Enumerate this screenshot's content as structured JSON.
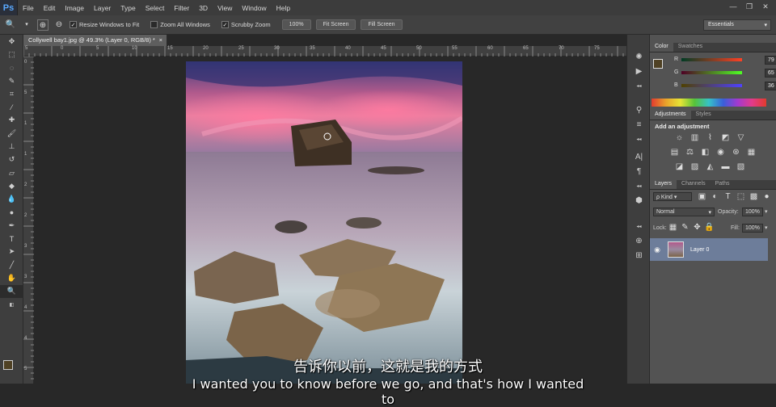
{
  "app": {
    "logo": "Ps"
  },
  "menu": [
    "File",
    "Edit",
    "Image",
    "Layer",
    "Type",
    "Select",
    "Filter",
    "3D",
    "View",
    "Window",
    "Help"
  ],
  "window_controls": [
    "—",
    "❐",
    "✕"
  ],
  "options": {
    "resize_label": "Resize Windows to Fit",
    "zoom_all_label": "Zoom All Windows",
    "scrubby_label": "Scrubby Zoom",
    "pct_button": "100%",
    "fit_button": "Fit Screen",
    "fill_button": "Fill Screen",
    "workspace": "Essentials"
  },
  "document": {
    "tab_title": "Collywell bay1.jpg @ 49.3% (Layer 0, RGB/8) *",
    "close": "×"
  },
  "ruler": {
    "h_labels": [
      "5",
      "0",
      "5",
      "10",
      "15",
      "20",
      "25",
      "30",
      "35",
      "40",
      "45",
      "50",
      "55",
      "60",
      "65",
      "70",
      "75"
    ],
    "v_labels": [
      "0",
      "5",
      "1",
      "1",
      "2",
      "2",
      "3",
      "3",
      "4",
      "4",
      "5"
    ]
  },
  "color_panel": {
    "tabs": [
      "Color",
      "Swatches"
    ],
    "r": {
      "label": "R",
      "value": "79"
    },
    "g": {
      "label": "G",
      "value": "65"
    },
    "b": {
      "label": "B",
      "value": "36"
    },
    "foreground": "#4f4124"
  },
  "adjustments_panel": {
    "tabs": [
      "Adjustments",
      "Styles"
    ],
    "title": "Add an adjustment"
  },
  "layers_panel": {
    "tabs": [
      "Layers",
      "Channels",
      "Paths"
    ],
    "kind": "ρ Kind",
    "blend_mode": "Normal",
    "opacity_label": "Opacity:",
    "opacity_value": "100%",
    "lock_label": "Lock:",
    "fill_label": "Fill:",
    "fill_value": "100%",
    "layer_name": "Layer 0"
  },
  "subtitles": {
    "line1": "告诉你以前，这就是我的方式",
    "line2": "I wanted you to know before we go, and that's how I wanted to"
  }
}
